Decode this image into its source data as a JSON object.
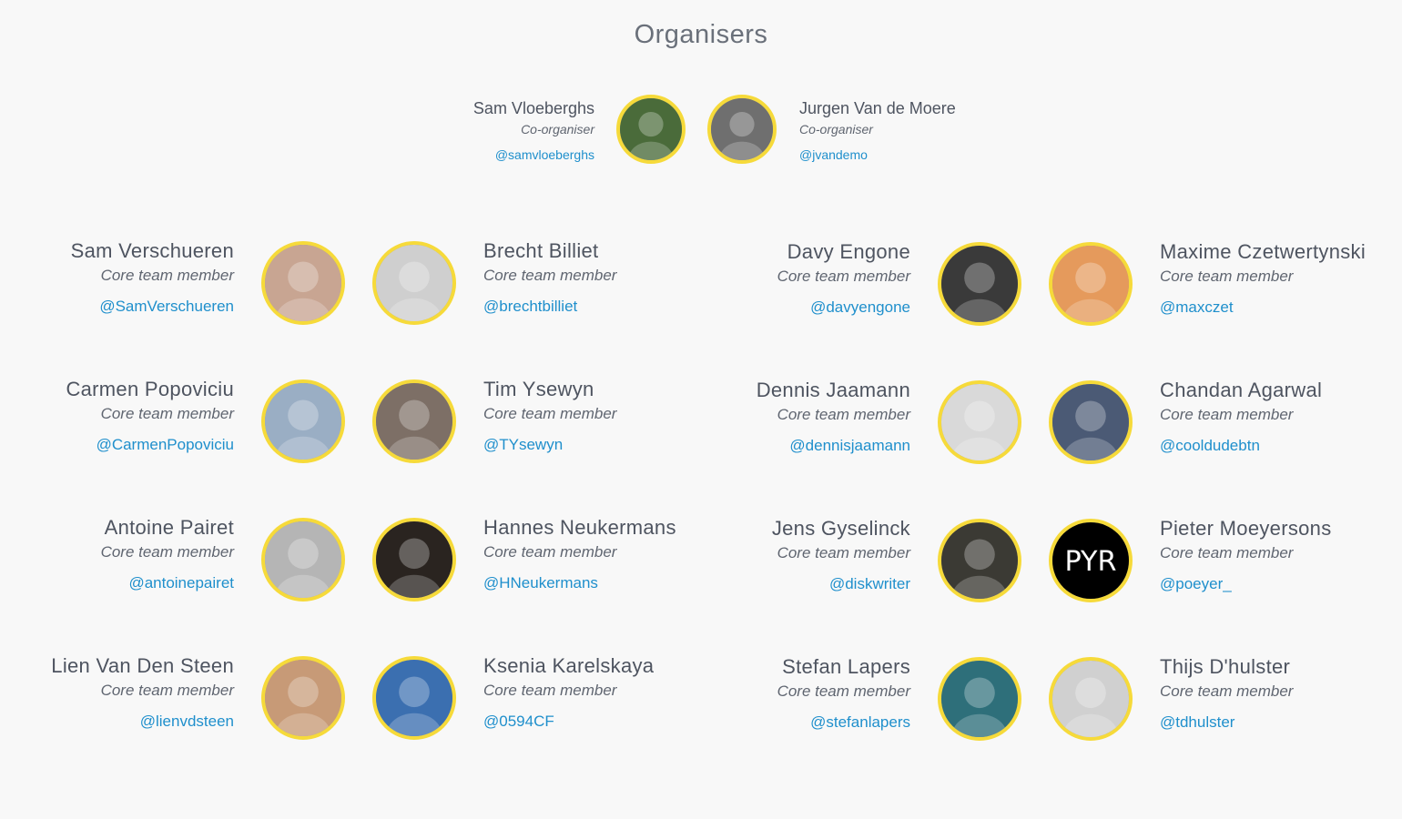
{
  "section_title": "Organisers",
  "organisers": [
    {
      "name": "Sam Vloeberghs",
      "role": "Co-organiser",
      "handle": "@samvloeberghs",
      "avatar_color": "#4a6b3a"
    },
    {
      "name": "Jurgen Van de Moere",
      "role": "Co-organiser",
      "handle": "@jvandemo",
      "avatar_color": "#6f6f6f"
    }
  ],
  "team": [
    {
      "name": "Sam Verschueren",
      "role": "Core team member",
      "handle": "@SamVerschueren",
      "avatar_color": "#c8a592"
    },
    {
      "name": "Brecht Billiet",
      "role": "Core team member",
      "handle": "@brechtbilliet",
      "avatar_color": "#cfcfcf"
    },
    {
      "name": "Davy Engone",
      "role": "Core team member",
      "handle": "@davyengone",
      "avatar_color": "#3a3a3a"
    },
    {
      "name": "Maxime Czetwertynski",
      "role": "Core team member",
      "handle": "@maxczet",
      "avatar_color": "#e59a5c"
    },
    {
      "name": "Carmen Popoviciu",
      "role": "Core team member",
      "handle": "@CarmenPopoviciu",
      "avatar_color": "#9aaec4"
    },
    {
      "name": "Tim Ysewyn",
      "role": "Core team member",
      "handle": "@TYsewyn",
      "avatar_color": "#7d6f66"
    },
    {
      "name": "Dennis Jaamann",
      "role": "Core team member",
      "handle": "@dennisjaamann",
      "avatar_color": "#d9d9d9"
    },
    {
      "name": "Chandan Agarwal",
      "role": "Core team member",
      "handle": "@cooldudebtn",
      "avatar_color": "#4b5a75"
    },
    {
      "name": "Antoine Pairet",
      "role": "Core team member",
      "handle": "@antoinepairet",
      "avatar_color": "#b5b5b5"
    },
    {
      "name": "Hannes Neukermans",
      "role": "Core team member",
      "handle": "@HNeukermans",
      "avatar_color": "#2a2420"
    },
    {
      "name": "Jens Gyselinck",
      "role": "Core team member",
      "handle": "@diskwriter",
      "avatar_color": "#3b3a34"
    },
    {
      "name": "Pieter Moeyersons",
      "role": "Core team member",
      "handle": "@poeyer_",
      "avatar_color": "#000000",
      "avatar_text": "PYR"
    },
    {
      "name": "Lien Van Den Steen",
      "role": "Core team member",
      "handle": "@lienvdsteen",
      "avatar_color": "#c79a77"
    },
    {
      "name": "Ksenia Karelskaya",
      "role": "Core team member",
      "handle": "@0594CF",
      "avatar_color": "#3b6fb0"
    },
    {
      "name": "Stefan Lapers",
      "role": "Core team member",
      "handle": "@stefanlapers",
      "avatar_color": "#2e6f7a"
    },
    {
      "name": "Thijs D'hulster",
      "role": "Core team member",
      "handle": "@tdhulster",
      "avatar_color": "#d0d0d0"
    }
  ]
}
